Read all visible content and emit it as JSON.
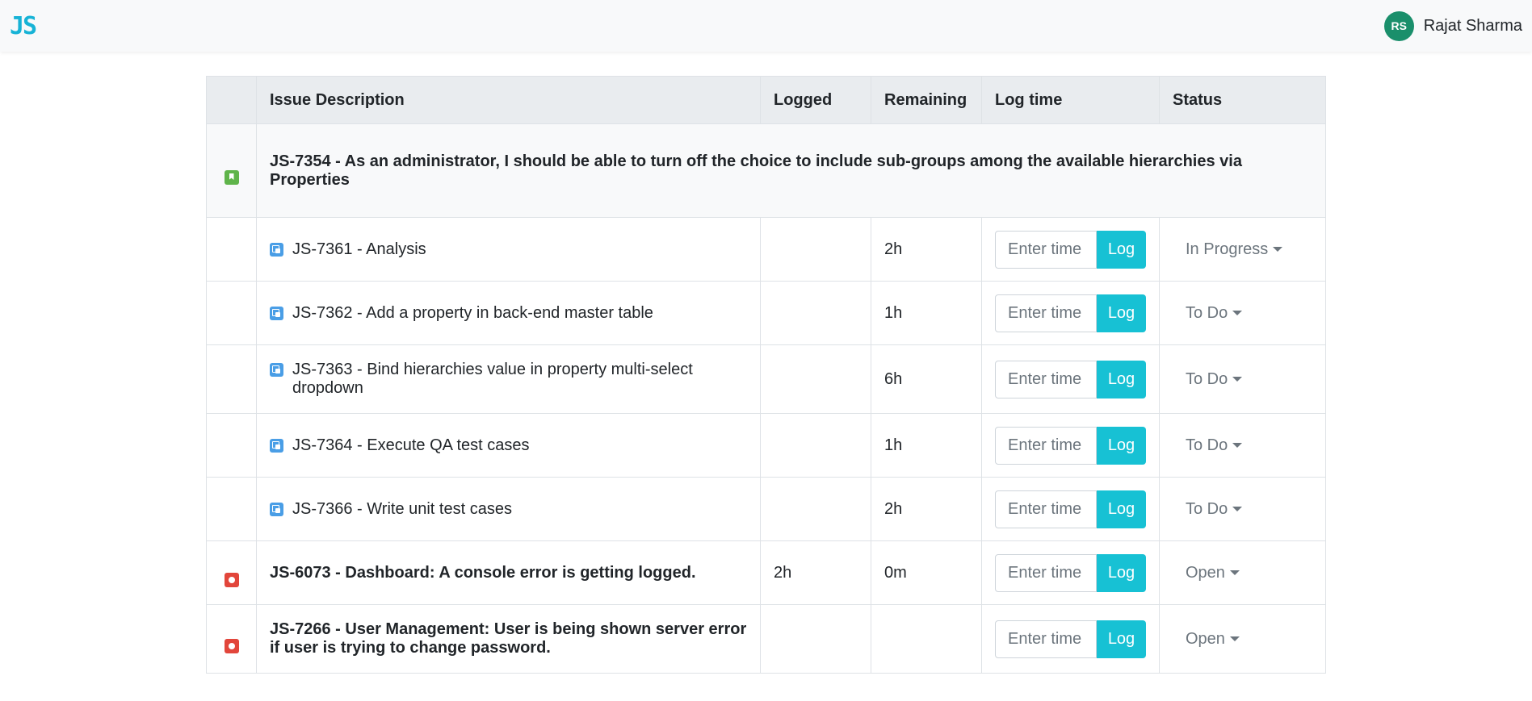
{
  "brand": {
    "logo": "JS"
  },
  "user": {
    "initials": "RS",
    "name": "Rajat Sharma",
    "avatar_color": "#1a8f6b"
  },
  "table": {
    "headers": [
      "",
      "Issue Description",
      "Logged",
      "Remaining",
      "Log time",
      "Status"
    ],
    "log_placeholder": "Enter time",
    "log_button": "Log",
    "rows": [
      {
        "type": "story",
        "icon": "story-icon",
        "desc": "JS-7354 - As an administrator, I should be able to turn off the choice to include sub-groups among the available hierarchies via Properties",
        "logged": "",
        "remaining": "",
        "status": ""
      },
      {
        "type": "subtask",
        "icon": "subtask-icon",
        "desc": "JS-7361 - Analysis",
        "logged": "",
        "remaining": "2h",
        "status": "In Progress"
      },
      {
        "type": "subtask",
        "icon": "subtask-icon",
        "desc": "JS-7362 - Add a property in back-end master table",
        "logged": "",
        "remaining": "1h",
        "status": "To Do"
      },
      {
        "type": "subtask",
        "icon": "subtask-icon",
        "desc": "JS-7363 - Bind hierarchies value in property multi-select dropdown",
        "logged": "",
        "remaining": "6h",
        "status": "To Do"
      },
      {
        "type": "subtask",
        "icon": "subtask-icon",
        "desc": "JS-7364 - Execute QA test cases",
        "logged": "",
        "remaining": "1h",
        "status": "To Do"
      },
      {
        "type": "subtask",
        "icon": "subtask-icon",
        "desc": "JS-7366 - Write unit test cases",
        "logged": "",
        "remaining": "2h",
        "status": "To Do"
      },
      {
        "type": "bug",
        "icon": "bug-icon",
        "desc": "JS-6073 - Dashboard: A console error is getting logged.",
        "logged": "2h",
        "remaining": "0m",
        "status": "Open"
      },
      {
        "type": "bug",
        "icon": "bug-icon",
        "desc": "JS-7266 - User Management: User is being shown server error if user is trying to change password.",
        "logged": "",
        "remaining": "",
        "status": "Open"
      }
    ]
  },
  "colors": {
    "accent": "#17c1d4",
    "story": "#5fb44a",
    "bug": "#e2463b",
    "subtask": "#4a9ee6"
  }
}
